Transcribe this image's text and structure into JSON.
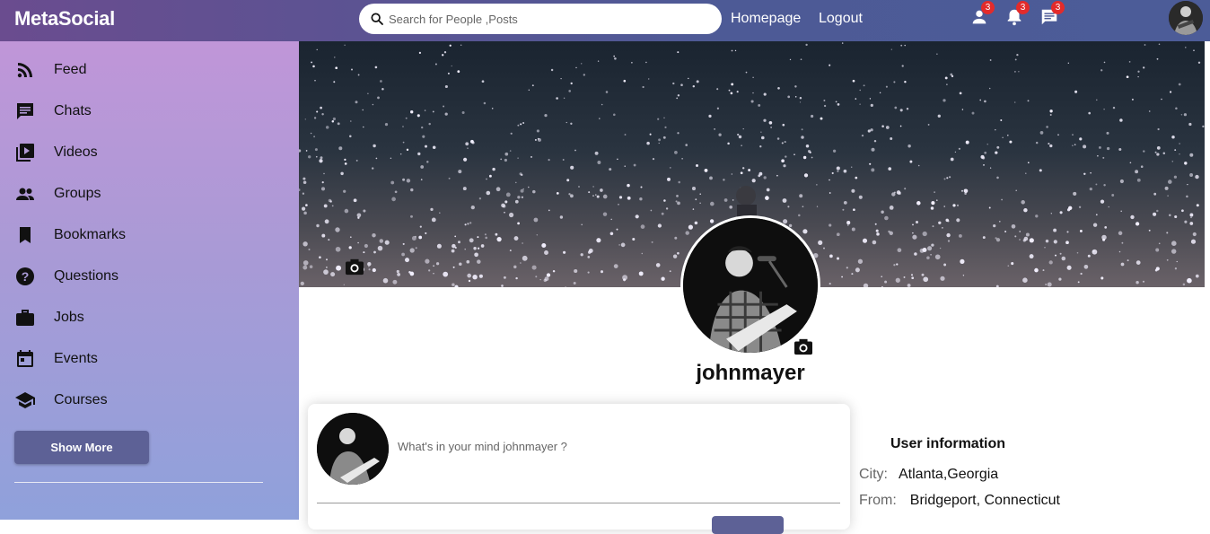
{
  "app": {
    "logo": "MetaSocial"
  },
  "search": {
    "placeholder": "Search for People ,Posts"
  },
  "topnav": {
    "homepage": "Homepage",
    "logout": "Logout"
  },
  "notifications": {
    "friend_requests": "3",
    "alerts": "3",
    "messages": "3"
  },
  "sidebar": {
    "items": [
      {
        "label": "Feed",
        "icon": "rss-feed-icon"
      },
      {
        "label": "Chats",
        "icon": "chat-icon"
      },
      {
        "label": "Videos",
        "icon": "video-library-icon"
      },
      {
        "label": "Groups",
        "icon": "group-icon"
      },
      {
        "label": "Bookmarks",
        "icon": "bookmark-icon"
      },
      {
        "label": "Questions",
        "icon": "help-icon"
      },
      {
        "label": "Jobs",
        "icon": "briefcase-icon"
      },
      {
        "label": "Events",
        "icon": "calendar-icon"
      },
      {
        "label": "Courses",
        "icon": "school-icon"
      }
    ],
    "show_more": "Show More"
  },
  "profile": {
    "username": "johnmayer"
  },
  "share": {
    "placeholder": "What's in your mind johnmayer ?"
  },
  "user_info": {
    "title": "User information",
    "rows": [
      {
        "key": "City:",
        "value": "Atlanta,Georgia"
      },
      {
        "key": "From:",
        "value": "Bridgeport, Connecticut"
      }
    ]
  },
  "colors": {
    "accent": "#5d6196",
    "badge": "#e32b2b"
  }
}
